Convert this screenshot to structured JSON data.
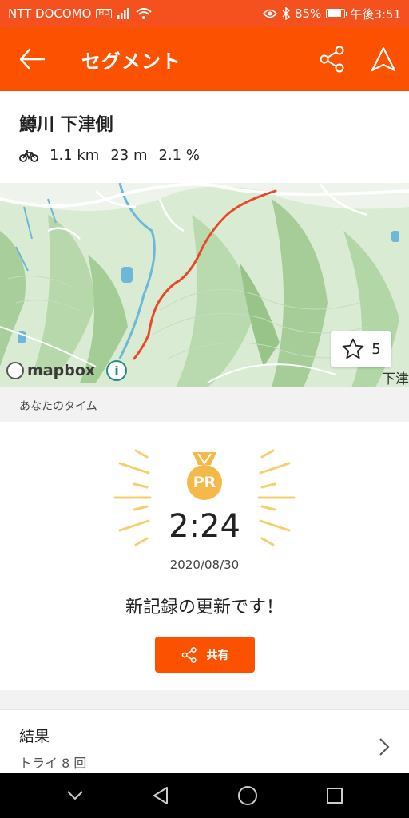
{
  "status_bar": {
    "carrier": "NTT DOCOMO",
    "hd_badge": "HD",
    "battery": "85%",
    "battery_level": 0.85,
    "time": "午後3:51"
  },
  "app_bar": {
    "title": "セグメント"
  },
  "segment": {
    "name": "鱒川 下津側",
    "distance": "1.1 km",
    "elevation": "23 m",
    "grade": "2.1 %"
  },
  "map": {
    "attribution": "mapbox",
    "star_count": "5",
    "edge_label": "下津",
    "route_color": "#e8492c"
  },
  "your_time": {
    "section_label": "あなたのタイム",
    "badge": "PR",
    "time": "2:24",
    "date": "2020/08/30",
    "message": "新記録の更新です！",
    "share_label": "共有"
  },
  "results": {
    "title": "結果",
    "attempts": "トライ 8 回"
  },
  "colors": {
    "accent": "#fc5200",
    "medal": "#f5b94a",
    "rays": "#f5cf6a"
  }
}
